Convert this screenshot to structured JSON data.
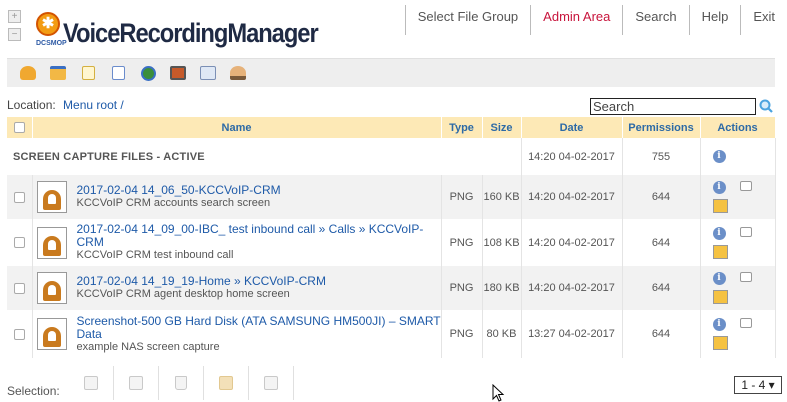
{
  "header": {
    "logo_text": "VoiceRecordingManager",
    "logo_sub": "DCSMOP",
    "nav": [
      {
        "label": "Select File Group",
        "active": false
      },
      {
        "label": "Admin Area",
        "active": true
      },
      {
        "label": "Search",
        "active": false
      },
      {
        "label": "Help",
        "active": false
      },
      {
        "label": "Exit",
        "active": false
      }
    ]
  },
  "toolbar": {
    "icons": [
      "up-folder-icon",
      "new-folder-icon",
      "new-file-icon",
      "upload-icon",
      "globe-icon",
      "gallery-icon",
      "details-view-icon",
      "users-icon"
    ]
  },
  "location": {
    "label": "Location:",
    "path": "Menu root /"
  },
  "search": {
    "placeholder": "Search"
  },
  "table": {
    "headers": {
      "name": "Name",
      "type": "Type",
      "size": "Size",
      "date": "Date",
      "permissions": "Permissions",
      "actions": "Actions"
    },
    "group": {
      "title": "SCREEN CAPTURE FILES - ACTIVE",
      "date": "14:20 04-02-2017",
      "permissions": "755"
    },
    "rows": [
      {
        "name": "2017-02-04 14_06_50-KCCVoIP-CRM",
        "desc": "KCCVoIP CRM accounts search screen",
        "type": "PNG",
        "size": "160 KB",
        "date": "14:20 04-02-2017",
        "permissions": "644"
      },
      {
        "name": "2017-02-04 14_09_00-IBC_ test inbound call » Calls » KCCVoIP-CRM",
        "desc": "KCCVoIP CRM test inbound call",
        "type": "PNG",
        "size": "108 KB",
        "date": "14:20 04-02-2017",
        "permissions": "644"
      },
      {
        "name": "2017-02-04 14_19_19-Home » KCCVoIP-CRM",
        "desc": "KCCVoIP CRM agent desktop home screen",
        "type": "PNG",
        "size": "180 KB",
        "date": "14:20 04-02-2017",
        "permissions": "644"
      },
      {
        "name": "Screenshot-500 GB Hard Disk (ATA SAMSUNG HM500JI) – SMART Data",
        "desc": "example NAS screen capture",
        "type": "PNG",
        "size": "80 KB",
        "date": "13:27 04-02-2017",
        "permissions": "644"
      }
    ]
  },
  "footer": {
    "selection_label": "Selection:",
    "pager": "1 - 4 ▾"
  }
}
